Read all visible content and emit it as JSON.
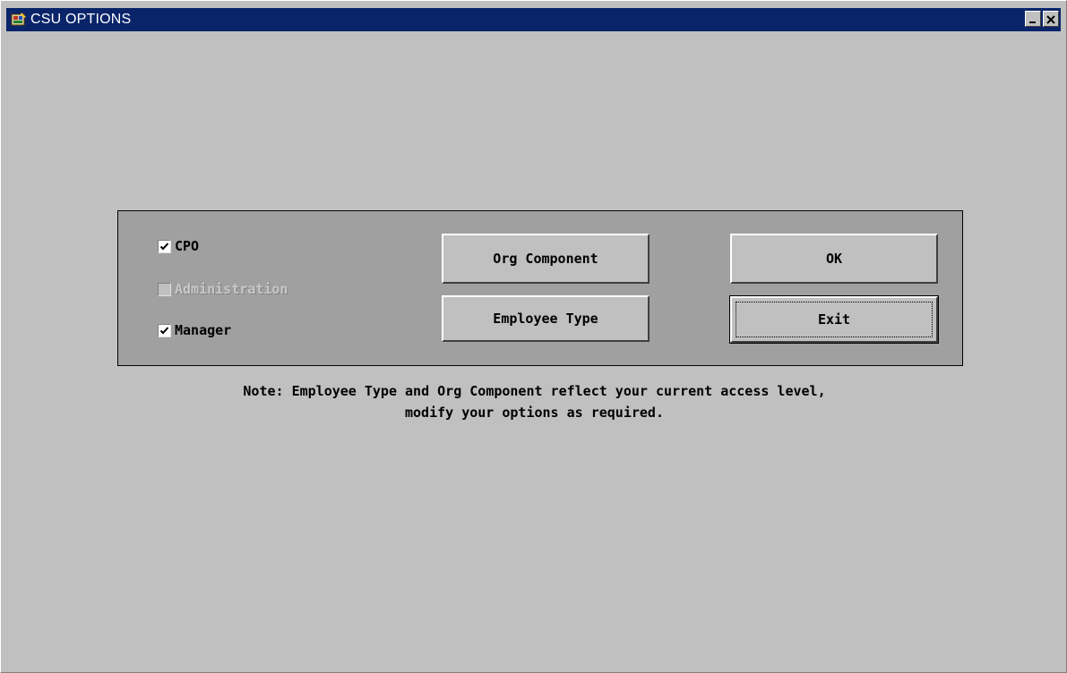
{
  "window": {
    "title": "CSU OPTIONS",
    "titlebar_color": "#0a246a",
    "background_color": "#c0c0c0"
  },
  "titlebar_buttons": {
    "minimize_icon": "minimize-icon",
    "close_icon": "close-icon"
  },
  "options": {
    "cpo": {
      "label": "CPO",
      "checked": true,
      "enabled": true
    },
    "administration": {
      "label": "Administration",
      "checked": false,
      "enabled": false
    },
    "manager": {
      "label": "Manager",
      "checked": true,
      "enabled": true
    }
  },
  "buttons": {
    "org_component": "Org Component",
    "employee_type": "Employee Type",
    "ok": "OK",
    "exit": "Exit"
  },
  "note": {
    "line1": "Note: Employee Type and Org Component reflect your current access level,",
    "line2": "modify your options as required."
  }
}
